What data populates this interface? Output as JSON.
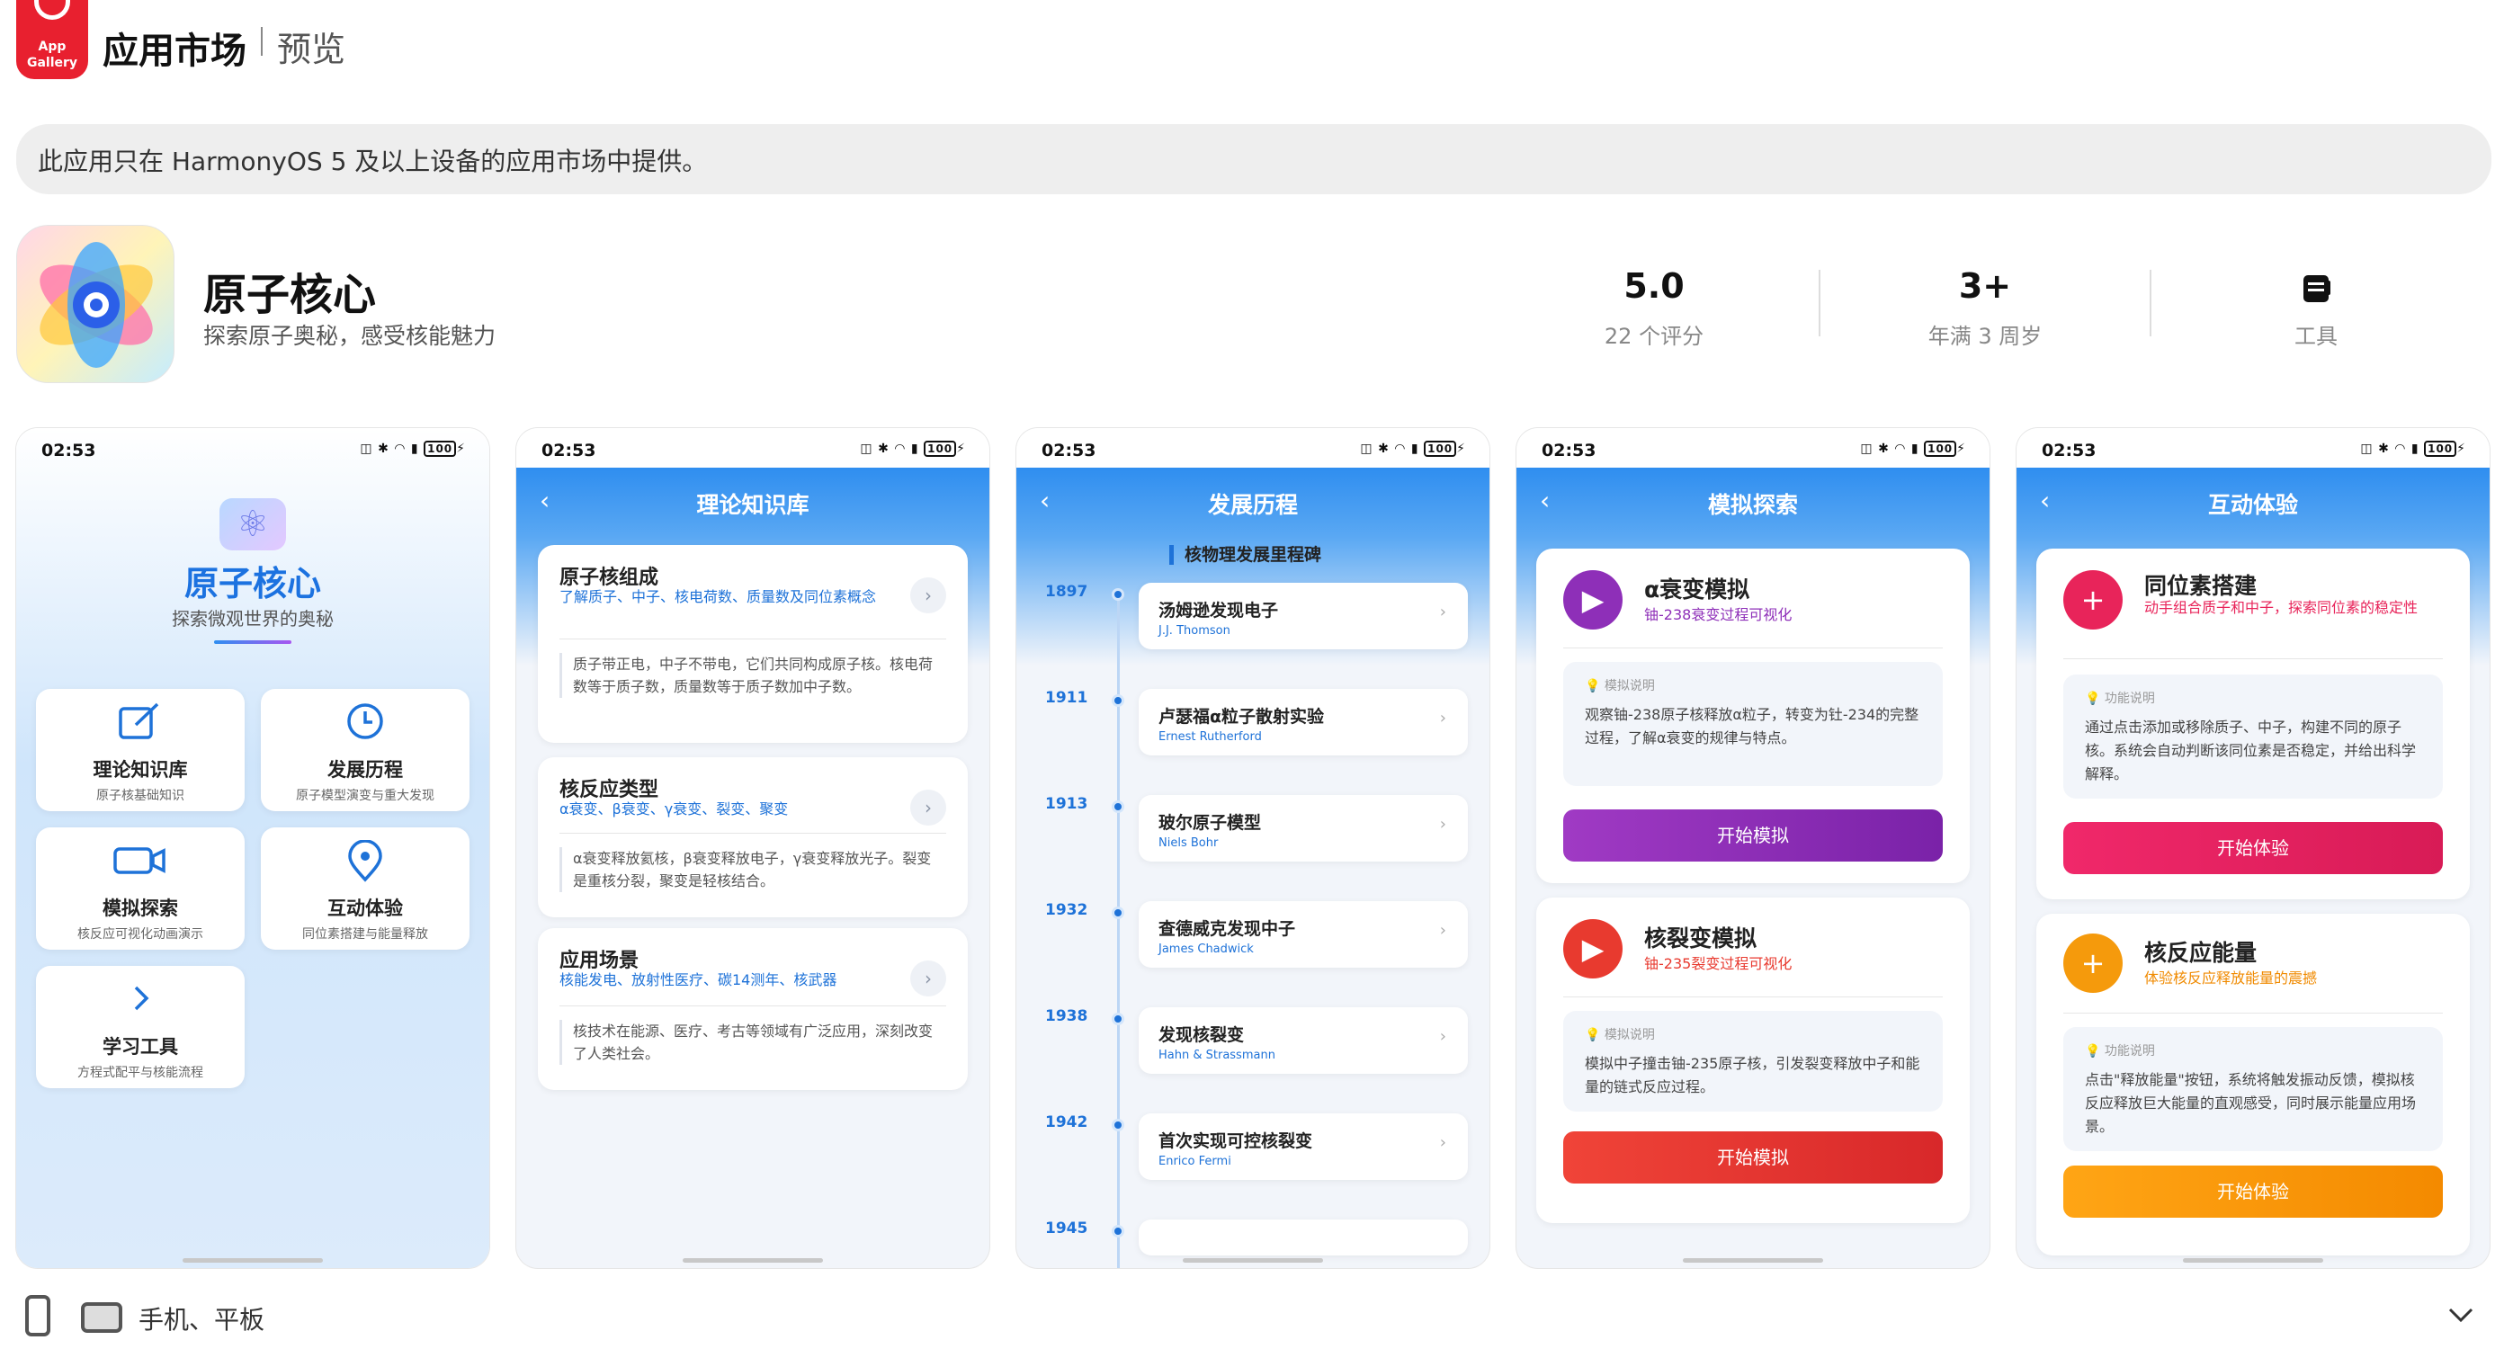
{
  "header": {
    "logo_line1": "App",
    "logo_line2": "Gallery",
    "title": "应用市场",
    "subtitle": "预览"
  },
  "notice": "此应用只在 HarmonyOS 5 及以上设备的应用市场中提供。",
  "app": {
    "name": "原子核心",
    "tagline": "探索原子奥秘，感受核能魅力",
    "stats": [
      {
        "value": "5.0",
        "label": "22 个评分"
      },
      {
        "value": "3+",
        "label": "年满 3 周岁"
      },
      {
        "value": "",
        "label": "工具"
      }
    ]
  },
  "status_bar": {
    "time": "02:53",
    "battery": "100"
  },
  "screens": {
    "home": {
      "title": "原子核心",
      "subtitle": "探索微观世界的奥秘",
      "tiles": [
        {
          "icon": "edit-icon",
          "name": "理论知识库",
          "desc": "原子核基础知识"
        },
        {
          "icon": "clock-icon",
          "name": "发展历程",
          "desc": "原子模型演变与重大发现"
        },
        {
          "icon": "video-icon",
          "name": "模拟探索",
          "desc": "核反应可视化动画演示"
        },
        {
          "icon": "location-icon",
          "name": "互动体验",
          "desc": "同位素搭建与能量释放"
        },
        {
          "icon": "chevron-right-icon",
          "name": "学习工具",
          "desc": "方程式配平与核能流程"
        }
      ]
    },
    "knowledge": {
      "title": "理论知识库",
      "cards": [
        {
          "title": "原子核组成",
          "tags": "了解质子、中子、核电荷数、质量数及同位素概念",
          "desc": "质子带正电，中子不带电，它们共同构成原子核。核电荷数等于质子数，质量数等于质子数加中子数。"
        },
        {
          "title": "核反应类型",
          "tags": "α衰变、β衰变、γ衰变、裂变、聚变",
          "desc": "α衰变释放氦核，β衰变释放电子，γ衰变释放光子。裂变是重核分裂，聚变是轻核结合。"
        },
        {
          "title": "应用场景",
          "tags": "核能发电、放射性医疗、碳14测年、核武器",
          "desc": "核技术在能源、医疗、考古等领域有广泛应用，深刻改变了人类社会。"
        }
      ]
    },
    "history": {
      "title": "发展历程",
      "heading": "核物理发展里程碑",
      "items": [
        {
          "year": "1897",
          "title": "汤姆逊发现电子",
          "person": "J.J. Thomson"
        },
        {
          "year": "1911",
          "title": "卢瑟福α粒子散射实验",
          "person": "Ernest Rutherford"
        },
        {
          "year": "1913",
          "title": "玻尔原子模型",
          "person": "Niels Bohr"
        },
        {
          "year": "1932",
          "title": "查德威克发现中子",
          "person": "James Chadwick"
        },
        {
          "year": "1938",
          "title": "发现核裂变",
          "person": "Hahn & Strassmann"
        },
        {
          "year": "1942",
          "title": "首次实现可控核裂变",
          "person": "Enrico Fermi"
        },
        {
          "year": "1945",
          "title": "",
          "person": ""
        }
      ]
    },
    "simulation": {
      "title": "模拟探索",
      "sections": [
        {
          "title": "α衰变模拟",
          "sub": "铀-238衰变过程可视化",
          "note_head": "模拟说明",
          "note": "观察铀-238原子核释放α粒子，转变为钍-234的完整过程，了解α衰变的规律与特点。",
          "button": "开始模拟",
          "color": "#8e2fb8"
        },
        {
          "title": "核裂变模拟",
          "sub": "铀-235裂变过程可视化",
          "note_head": "模拟说明",
          "note": "模拟中子撞击铀-235原子核，引发裂变释放中子和能量的链式反应过程。",
          "button": "开始模拟",
          "color": "#e83a2f"
        }
      ]
    },
    "interactive": {
      "title": "互动体验",
      "sections": [
        {
          "title": "同位素搭建",
          "sub": "动手组合质子和中子，探索同位素的稳定性",
          "note_head": "功能说明",
          "note": "通过点击添加或移除质子、中子，构建不同的原子核。系统会自动判断该同位素是否稳定，并给出科学解释。",
          "button": "开始体验",
          "color": "#e8245a"
        },
        {
          "title": "核反应能量",
          "sub": "体验核反应释放能量的震撼",
          "note_head": "功能说明",
          "note": "点击\"释放能量\"按钮，系统将触发振动反馈，模拟核反应释放巨大能量的直观感受，同时展示能量应用场景。",
          "button": "开始体验",
          "color": "#f59a0c"
        }
      ]
    }
  },
  "footer": {
    "devices": "手机、平板"
  }
}
